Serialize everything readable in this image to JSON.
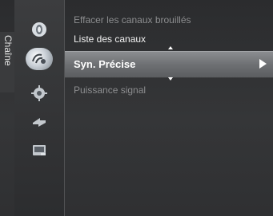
{
  "category": {
    "label": "Chaîne"
  },
  "menu": {
    "items": [
      {
        "label": "Effacer les canaux brouillés"
      },
      {
        "label": "Liste des canaux"
      },
      {
        "label": "Syn. Précise"
      },
      {
        "label": "Puissance signal"
      }
    ],
    "selected_index": 2
  },
  "icons": [
    "picture-icon",
    "channel-icon",
    "settings-gear-icon",
    "input-icon",
    "application-icon"
  ],
  "colors": {
    "selection_bar": "#7a7c7f",
    "text_active": "#ffffff",
    "text_dim": "#8c8d8f"
  }
}
